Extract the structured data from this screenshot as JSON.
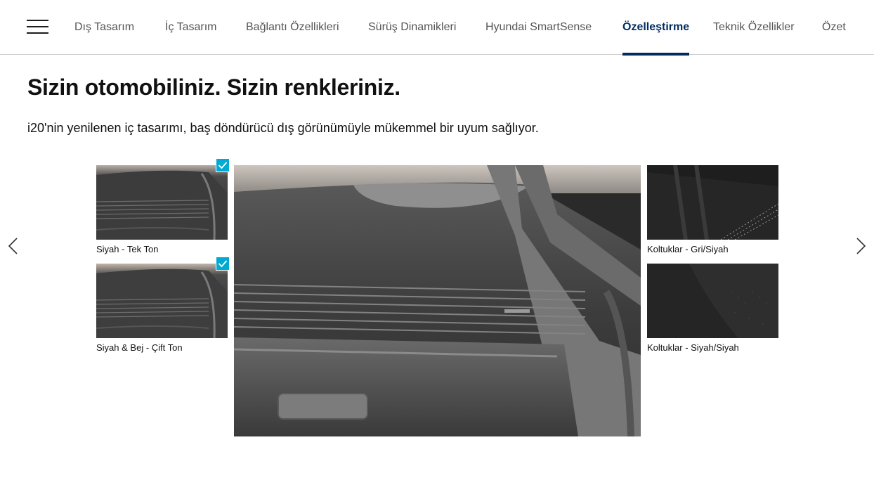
{
  "nav": {
    "menu_icon": "hamburger-menu-icon",
    "items": [
      {
        "label": "Dış Tasarım",
        "active": false
      },
      {
        "label": "İç Tasarım",
        "active": false
      },
      {
        "label": "Bağlantı Özellikleri",
        "active": false
      },
      {
        "label": "Sürüş Dinamikleri",
        "active": false
      },
      {
        "label": "Hyundai SmartSense",
        "active": false
      },
      {
        "label": "Özelleştirme",
        "active": true
      },
      {
        "label": "Teknik Özellikler",
        "active": false
      },
      {
        "label": "Özet",
        "active": false
      }
    ]
  },
  "content": {
    "title": "Sizin otomobiliniz. Sizin renkleriniz.",
    "subtitle": "i20'nin yenilenen iç tasarımı, baş döndürücü dış görünümüyle mükemmel bir uyum sağlıyor."
  },
  "carousel": {
    "prev_icon": "chevron-left-icon",
    "next_icon": "chevron-right-icon",
    "interior_options": [
      {
        "label": "Siyah - Tek Ton",
        "selected": true
      },
      {
        "label": "Siyah & Bej - Çift Ton",
        "selected": true
      }
    ],
    "seat_options": [
      {
        "label": "Koltuklar - Gri/Siyah"
      },
      {
        "label": "Koltuklar - Siyah/Siyah"
      }
    ]
  },
  "colors": {
    "brand": "#002c5f",
    "check": "#00aad2",
    "nav_text": "#555555",
    "divider": "#cfcfcf"
  }
}
